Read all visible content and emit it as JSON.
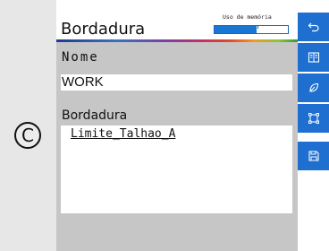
{
  "marker": "C",
  "header": {
    "title": "Bordadura",
    "memory": {
      "label": "Uso de memória",
      "usage_fraction": 0.57
    }
  },
  "form": {
    "nome_label": "Nome",
    "nome_value": "WORK",
    "bordadura_label": "Bordadura",
    "bordadura_items": [
      "Limite_Talhao_A"
    ]
  },
  "sidebar": {
    "buttons": [
      {
        "icon": "back-arrow-icon"
      },
      {
        "icon": "map-book-icon"
      },
      {
        "icon": "leaf-icon"
      },
      {
        "icon": "frame-icon"
      },
      {
        "icon": "save-icon"
      }
    ]
  },
  "colors": {
    "accent_blue": "#1e6fd0",
    "panel_gray": "#c6c6c6"
  }
}
